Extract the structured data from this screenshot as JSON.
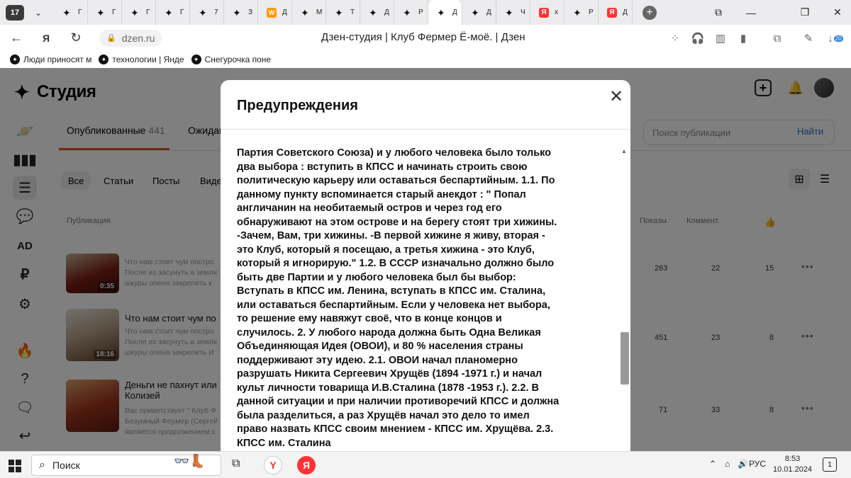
{
  "browser": {
    "tab_count": "17",
    "tabs": [
      {
        "label": "Г",
        "icon": "dzen-star-icon"
      },
      {
        "label": "Г",
        "icon": "dzen-star-icon"
      },
      {
        "label": "Г",
        "icon": "dzen-star-icon"
      },
      {
        "label": "Г",
        "icon": "dzen-star-icon"
      },
      {
        "label": "7",
        "icon": "dzen-star-icon"
      },
      {
        "label": "З",
        "icon": "dzen-star-icon"
      },
      {
        "label": "Д",
        "icon": "w-icon"
      },
      {
        "label": "М",
        "icon": "dzen-star-icon"
      },
      {
        "label": "Т",
        "icon": "dzen-star-icon"
      },
      {
        "label": "Д",
        "icon": "dzen-star-icon"
      },
      {
        "label": "Р",
        "icon": "dzen-star-icon"
      },
      {
        "label": "Д",
        "icon": "dzen-star-icon",
        "active": true
      },
      {
        "label": "Д",
        "icon": "dzen-star-icon"
      },
      {
        "label": "Ч",
        "icon": "dzen-star-icon"
      },
      {
        "label": "х",
        "icon": "yandex-icon"
      },
      {
        "label": "Р",
        "icon": "dzen-star-icon"
      },
      {
        "label": "Д",
        "icon": "yandex-icon"
      }
    ],
    "url": "dzen.ru",
    "page_title": "Дзен-студия | Клуб Фермер Ё-моё. | Дзен",
    "downloads_badge": "20",
    "bookmarks": [
      "Люди приносят м",
      "технологии | Янде",
      "Снегурочка поне"
    ]
  },
  "studio": {
    "logo": "Студия",
    "tabs": {
      "published_label": "Опубликованные",
      "published_count": "441",
      "waiting_label": "Ожидан"
    },
    "search_placeholder": "Поиск публикации",
    "search_button": "Найти",
    "filters": [
      "Все",
      "Статьи",
      "Посты",
      "Виде"
    ],
    "columns": {
      "publication": "Публикация",
      "views": "Показы",
      "comments": "Коммент."
    },
    "rows": [
      {
        "title": "",
        "desc": [
          "Что нам стоит чум постро",
          "После из засунуть в землю",
          "шкуры оленя закрепить к"
        ],
        "duration": "0:35",
        "views": "263",
        "comments": "22",
        "likes": "15"
      },
      {
        "title": "Что нам стоит чум по",
        "desc": [
          "Что нам стоит чум постро",
          "После из засунуть в землю",
          "шкуры оленя закрепить И"
        ],
        "duration": "18:16",
        "views": "451",
        "comments": "23",
        "likes": "8"
      },
      {
        "title": "Деньги не пахнут или",
        "title2": "Колизей",
        "desc": [
          "Вас приветствует \" Клуб Ф",
          "Безумный Фермер (Сергей",
          "является продолжением с"
        ],
        "duration": "",
        "views": "71",
        "comments": "33",
        "likes": "8"
      }
    ],
    "more_label": "•••"
  },
  "modal": {
    "title": "Предупреждения",
    "close": "✕",
    "body": "Партия Советского Союза) и у любого человека было только два выбора : вступить в КПСС и начинать строить свою политическую карьеру или оставаться беспартийным. 1.1. По данному пункту вспоминается старый анекдот : \" Попал англичанин на необитаемый остров и через год его обнаруживают на этом острове и на берегу стоят три хижины. -Зачем, Вам, три хижины. -В первой хижине я живу, вторая - это Клуб, который я посещаю, а третья хижина - это Клуб, который я игнорирую.\" 1.2. В СССР изначально должно было быть две Партии и у любого человека был бы выбор: Вступать в КПСС им. Ленина, вступать в КПСС им. Сталина, или оставаться беспартийным. Если у человека нет выбора, то решение ему навяжут своё, что в конце концов и случилось. 2. У любого народа должна быть Одна Великая Объединяющая Идея (ОВОИ), и 80 % населения страны поддерживают эту идею. 2.1. ОВОИ начал планомерно разрушать Никита Сергеевич Хрущёв (1894 -1971 г.) и начал культ личности товарища И.В.Сталина (1878 -1953 г.). 2.2. В данной ситуации и при наличии противоречий КПСС и должна была разделиться, а раз Хрущёв начал это дело то имел право назвать КПСС своим мнением - КПСС им. Хрущёва. 2.3. КПСС им. Сталина"
  },
  "taskbar": {
    "search_label": "Поиск",
    "language": "РУС",
    "time": "8:53",
    "date": "10.01.2024",
    "notification_count": "1"
  },
  "colors": {
    "accent_tab_underline": "#e05a2b",
    "search_button": "#2f6ec8",
    "yandex_red": "#ff3333"
  }
}
